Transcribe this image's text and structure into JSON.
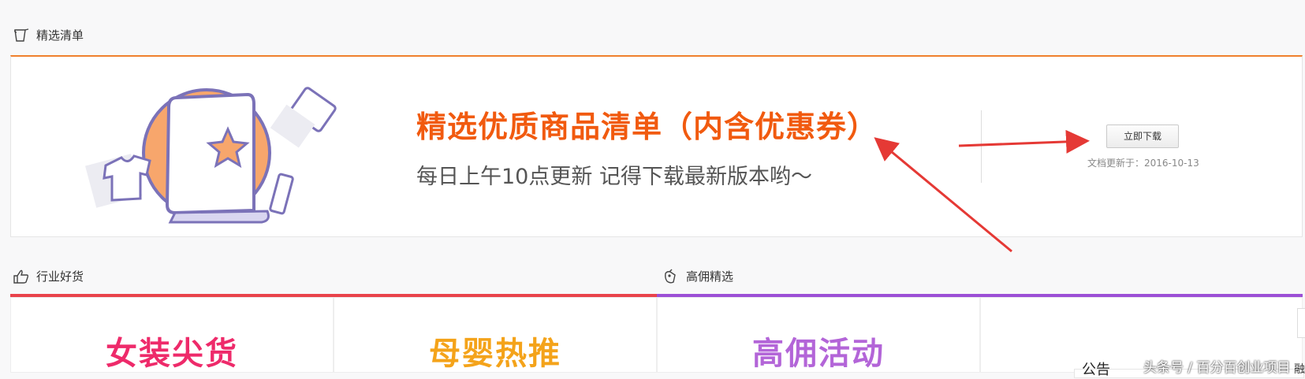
{
  "selected": {
    "heading": "精选清单",
    "title": "精选优质商品清单（内含优惠券）",
    "subtitle": "每日上午10点更新  记得下载最新版本哟～",
    "download_label": "立即下载",
    "updated_text": "文档更新于：2016-10-13",
    "accent": "#f0802d",
    "title_color": "#f15a0f"
  },
  "industry": {
    "heading": "行业好货",
    "bar_color": "#e9434b"
  },
  "commission": {
    "heading": "高佣精选",
    "bar_color": "#9c4fd6"
  },
  "cards": [
    {
      "label": "女装尖货",
      "color": "#ee2a6a"
    },
    {
      "label": "母婴热推",
      "color": "#f4a31a"
    },
    {
      "label": "高佣活动",
      "color": "#b365d8"
    },
    {
      "label": "",
      "color": "#ffffff"
    }
  ],
  "notice": {
    "label": "公告"
  },
  "watermark": "头条号 / 百分百创业项目",
  "corner_glyph": "融",
  "icons": [
    "scroll-icon",
    "thumbs-up-icon",
    "tag-icon"
  ]
}
